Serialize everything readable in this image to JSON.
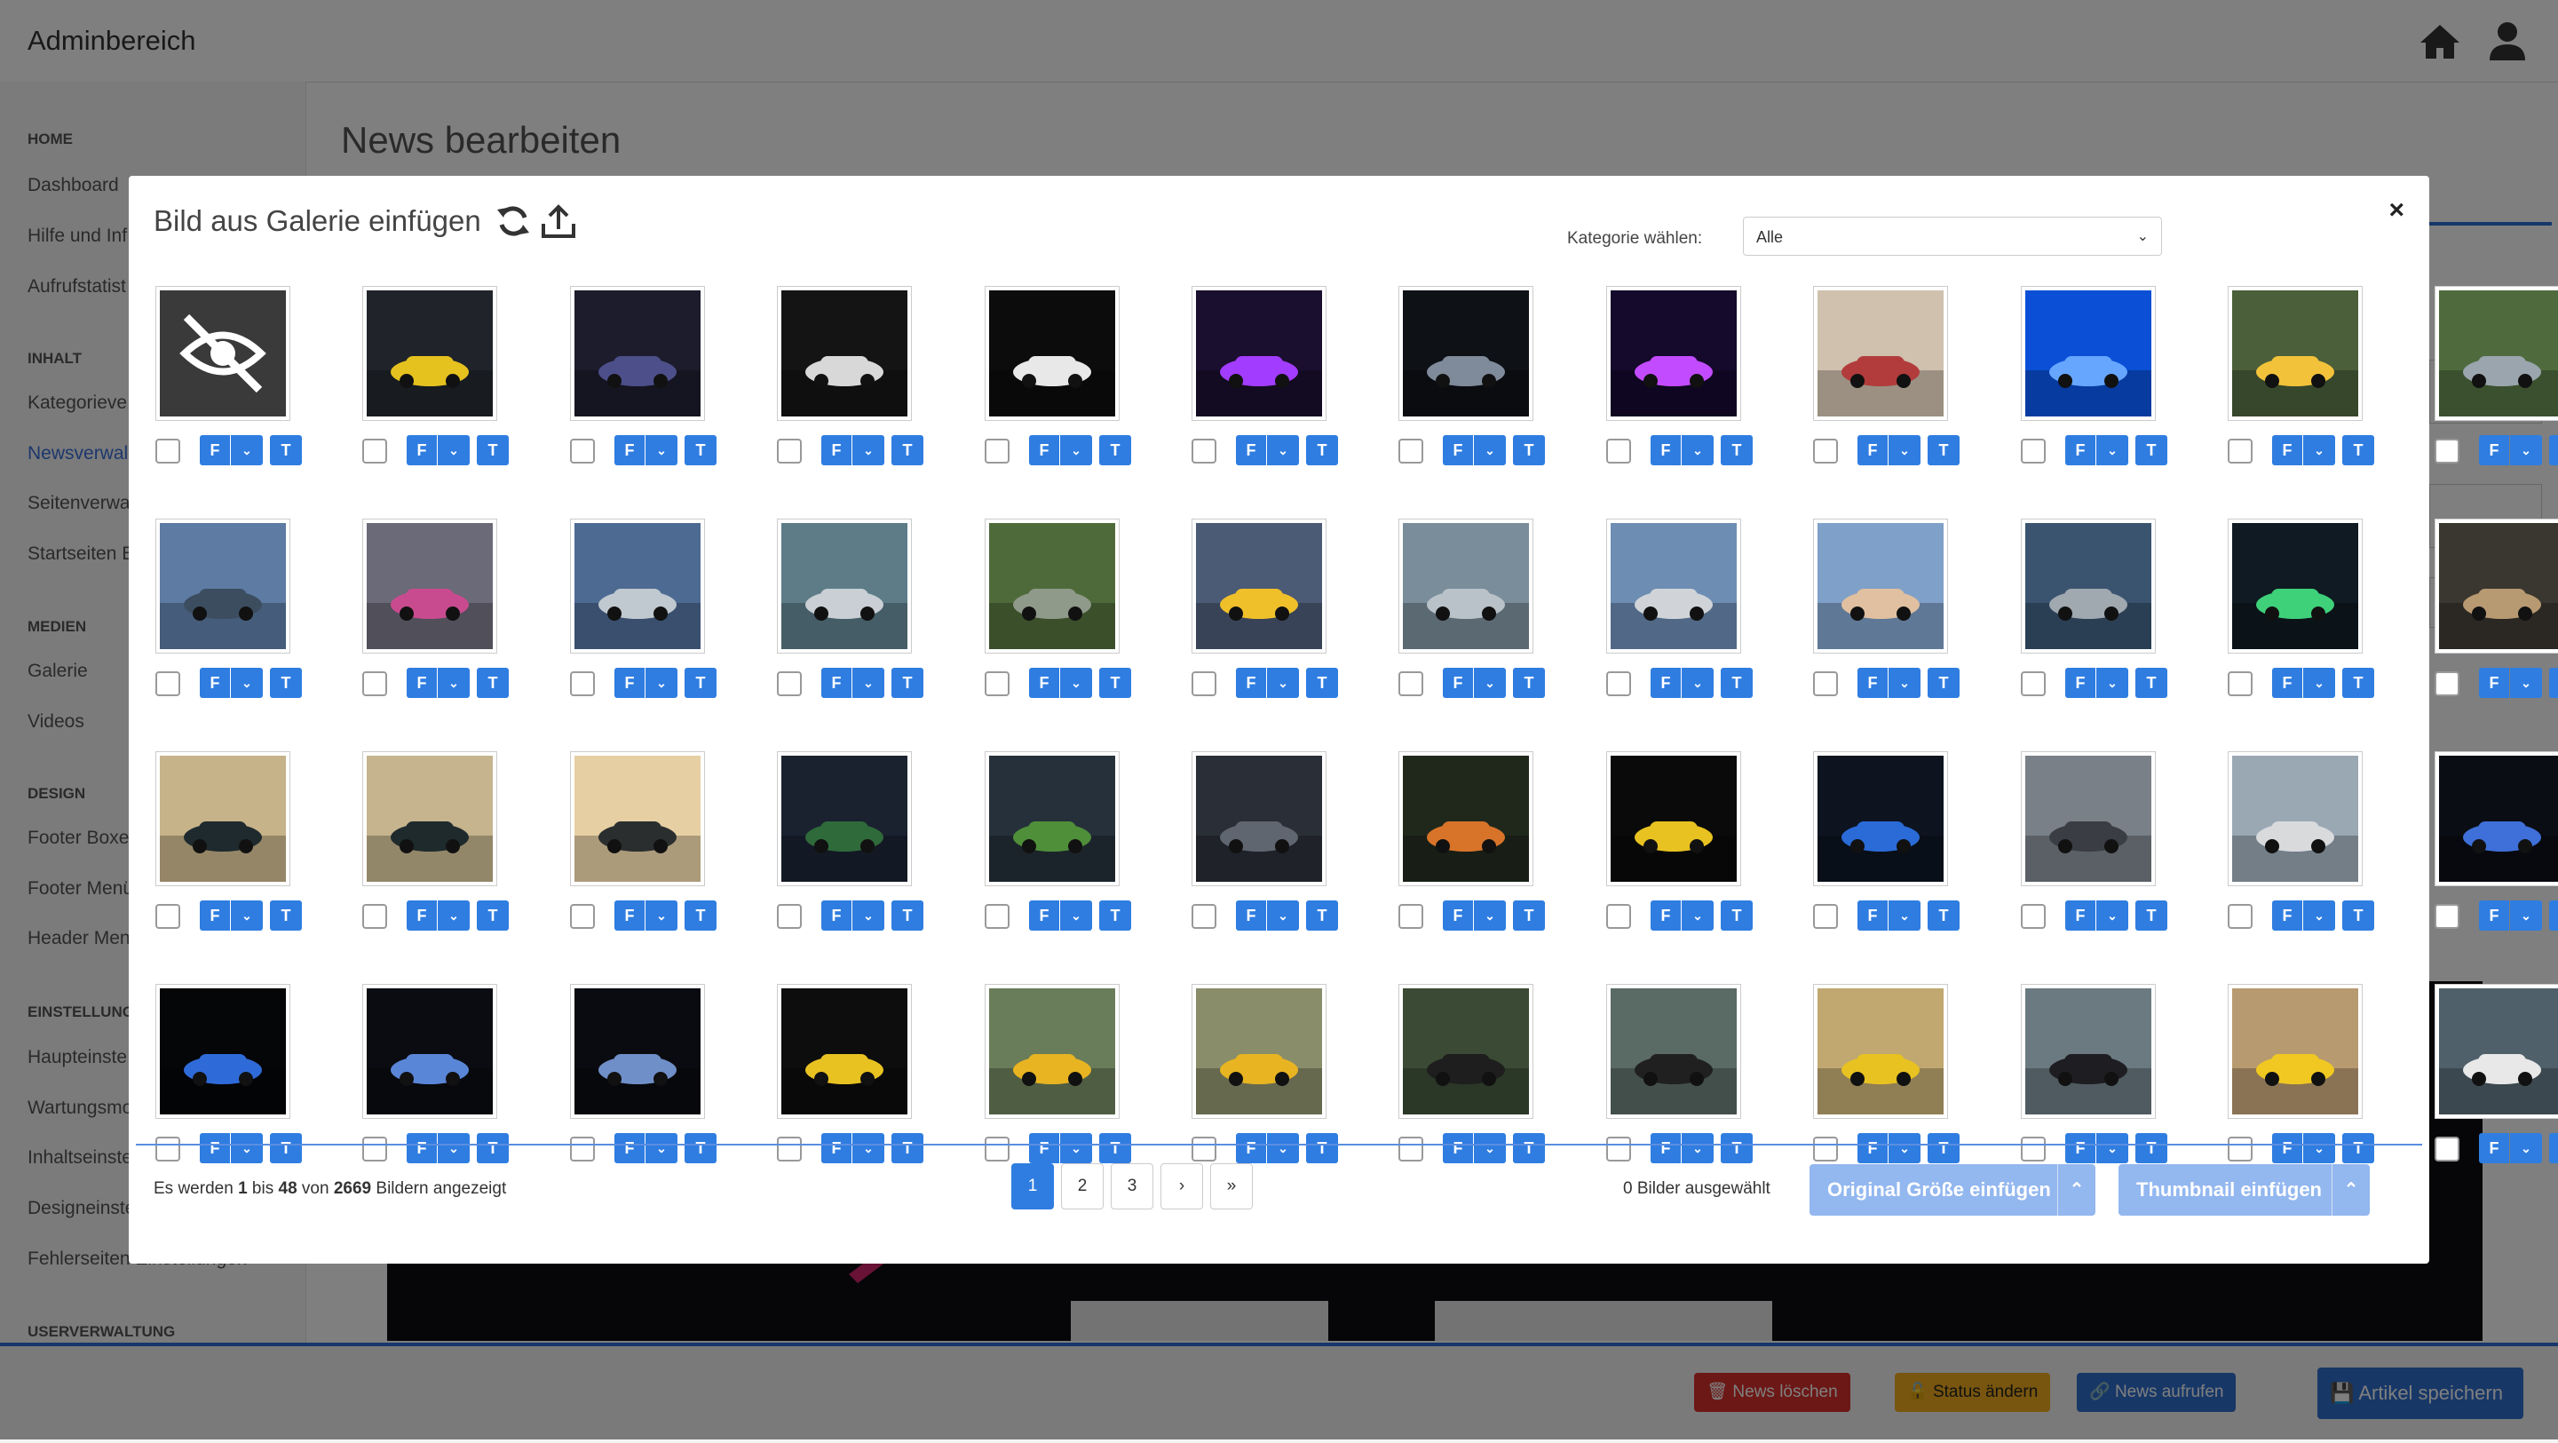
{
  "app": {
    "title": "Adminbereich"
  },
  "page": {
    "title": "News bearbeiten"
  },
  "sidebar": {
    "sections": [
      {
        "label": "HOME",
        "items": [
          "Dashboard",
          "Hilfe und Inf",
          "Aufrufstatist"
        ]
      },
      {
        "label": "INHALT",
        "items": [
          "Kategorieve",
          "Newsverwal",
          "Seitenverwa",
          "Startseiten E"
        ]
      },
      {
        "label": "MEDIEN",
        "items": [
          "Galerie",
          "Videos"
        ]
      },
      {
        "label": "DESIGN",
        "items": [
          "Footer Boxe",
          "Footer Menü",
          "Header Men"
        ]
      },
      {
        "label": "EINSTELLUNGE",
        "items": [
          "Haupteinste",
          "Wartungsmo",
          "Inhaltseinste",
          "Designeinste",
          "Fehlerseiten Einstellungen"
        ]
      },
      {
        "label": "USERVERWALTUNG",
        "items": []
      }
    ],
    "active_item": "Newsverwal"
  },
  "bottom_actions": {
    "delete": "News löschen",
    "status": "Status ändern",
    "view": "News aufrufen",
    "save": "Artikel speichern"
  },
  "modal": {
    "title": "Bild aus Galerie einfügen",
    "category_label": "Kategorie wählen:",
    "category_value": "Alle",
    "close": "×",
    "button_f": "F",
    "button_t": "T",
    "images": [
      "hidden",
      "yellow-supercar",
      "purple-coupe",
      "logo-bm-garage",
      "logo-bm-white",
      "purple-neon-abstract",
      "dashboard-night",
      "neon-highway",
      "pink-coupe-desert",
      "blue-neon-tunnel",
      "race-sunset-city",
      "race-road-trees",
      "race-street-blue",
      "race-city-gate",
      "race-boulevard",
      "race-city-green",
      "race-garden",
      "race-track-yellow",
      "silver-sedan",
      "city-race",
      "palm-race",
      "downtown-race",
      "night-race",
      "dark-coupe-sand",
      "black-coupe-palm",
      "black-coupe-palm-2",
      "black-coupe-beach",
      "green-coupe-night",
      "green-coupe-drift",
      "green-coupe-garage",
      "green-coupe-fire",
      "yellow-gt-garage",
      "blue-sportscar-stage",
      "wheel-closeup",
      "silver-car-lot",
      "blue-car-showroom",
      "blue-roadster-dark",
      "blue-roadster-stage",
      "blue-roadster-showroom",
      "gold-gt-showroom",
      "yellow-gt-desert",
      "yellow-gt-road",
      "black-gt-mud",
      "black-gt-beach",
      "yellow-gt-desert-2",
      "black-gt-palms",
      "yellow-roadster-front",
      "white-gt-stage"
    ],
    "status": {
      "prefix": "Es werden",
      "from": "1",
      "mid1": "bis",
      "to": "48",
      "mid2": "von",
      "total": "2669",
      "suffix": "Bildern angezeigt"
    },
    "pagination": [
      "1",
      "2",
      "3",
      "›",
      "»"
    ],
    "active_page": "1",
    "selected_count": "0 Bilder ausgewählt",
    "insert_original": "Original Größe einfügen",
    "insert_thumbnail": "Thumbnail einfügen"
  }
}
